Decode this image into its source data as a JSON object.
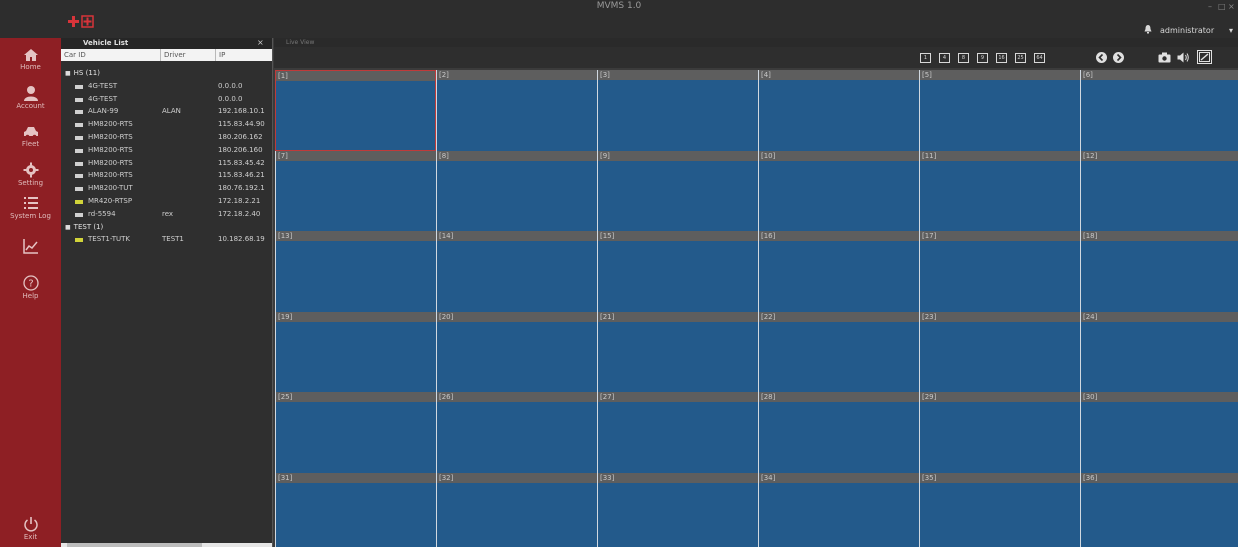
{
  "app": {
    "title": "MVMS 1.0",
    "brand_icon": "red-cross-logo"
  },
  "user": {
    "name": "administrator",
    "caret": "▾"
  },
  "window_controls": {
    "minimize": "–",
    "maximize": "□",
    "close": "×"
  },
  "sidebar": {
    "items": [
      {
        "label": "Home",
        "icon": "home-icon"
      },
      {
        "label": "Account",
        "icon": "account-icon"
      },
      {
        "label": "Fleet",
        "icon": "car-icon"
      },
      {
        "label": "Setting",
        "icon": "gear-icon"
      },
      {
        "label": "System Log",
        "icon": "list-icon"
      },
      {
        "label": "",
        "icon": "chart-icon"
      },
      {
        "label": "Help",
        "icon": "help-icon"
      }
    ],
    "exit": {
      "label": "Exit",
      "icon": "power-icon"
    }
  },
  "vehicle_list": {
    "title": "Vehicle List",
    "close": "× ×",
    "columns": [
      "Car ID",
      "Driver",
      "IP"
    ],
    "groups": [
      {
        "name": "HS (11)",
        "vehicles": [
          {
            "car_id": "4G-TEST",
            "driver": "",
            "ip": "0.0.0.0",
            "online": false
          },
          {
            "car_id": "4G-TEST",
            "driver": "",
            "ip": "0.0.0.0",
            "online": false
          },
          {
            "car_id": "ALAN-99",
            "driver": "ALAN",
            "ip": "192.168.10.1",
            "online": false
          },
          {
            "car_id": "HM8200-RTS",
            "driver": "",
            "ip": "115.83.44.90",
            "online": false
          },
          {
            "car_id": "HM8200-RTS",
            "driver": "",
            "ip": "180.206.162",
            "online": false
          },
          {
            "car_id": "HM8200-RTS",
            "driver": "",
            "ip": "180.206.160",
            "online": false
          },
          {
            "car_id": "HM8200-RTS",
            "driver": "",
            "ip": "115.83.45.42",
            "online": false
          },
          {
            "car_id": "HM8200-RTS",
            "driver": "",
            "ip": "115.83.46.21",
            "online": false
          },
          {
            "car_id": "HM8200-TUT",
            "driver": "",
            "ip": "180.76.192.1",
            "online": false
          },
          {
            "car_id": "MR420-RTSP",
            "driver": "",
            "ip": "172.18.2.21",
            "online": true
          },
          {
            "car_id": "rd-5594",
            "driver": "rex",
            "ip": "172.18.2.40",
            "online": false
          }
        ]
      },
      {
        "name": "TEST (1)",
        "vehicles": [
          {
            "car_id": "TEST1-TUTK",
            "driver": "TEST1",
            "ip": "10.182.68.19",
            "online": true
          }
        ]
      }
    ]
  },
  "live_view": {
    "tab": "Live View",
    "layout_buttons": [
      "1",
      "4",
      "8",
      "9",
      "16",
      "25",
      "64"
    ],
    "nav_icons": [
      "prev-icon",
      "next-icon"
    ],
    "tool_icons": [
      "camera-icon",
      "speaker-icon",
      "fullscreen-icon"
    ],
    "channels": [
      "[1]",
      "[2]",
      "[3]",
      "[4]",
      "[5]",
      "[6]",
      "[7]",
      "[8]",
      "[9]",
      "[10]",
      "[11]",
      "[12]",
      "[13]",
      "[14]",
      "[15]",
      "[16]",
      "[17]",
      "[18]",
      "[19]",
      "[20]",
      "[21]",
      "[22]",
      "[23]",
      "[24]",
      "[25]",
      "[26]",
      "[27]",
      "[28]",
      "[29]",
      "[30]",
      "[31]",
      "[32]",
      "[33]",
      "[34]",
      "[35]",
      "[36]"
    ],
    "selected_channel": "[1]"
  },
  "colors": {
    "accent": "#8e1f24",
    "video": "#235a8b",
    "header": "#5e5e5e",
    "online": "#d1d43a"
  }
}
